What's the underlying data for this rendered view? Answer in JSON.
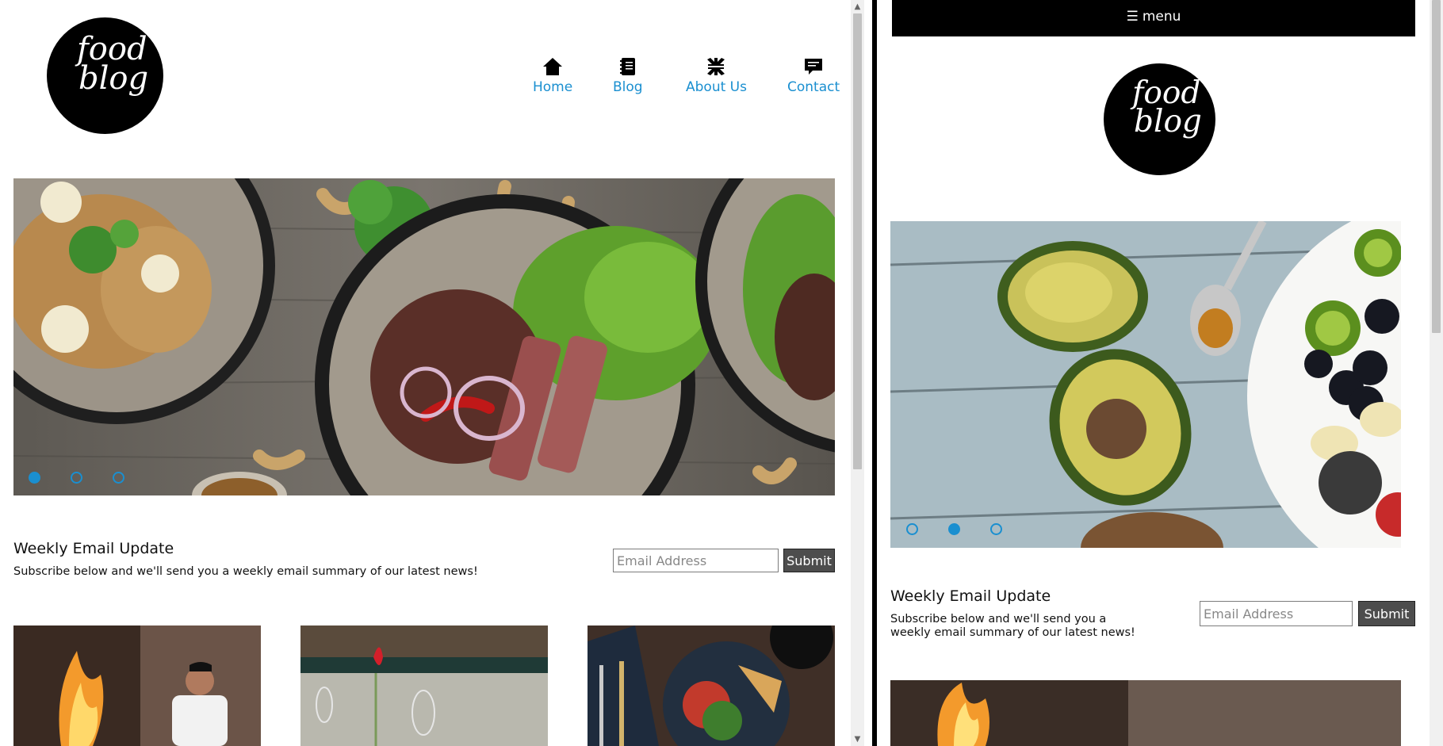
{
  "desktop": {
    "logo": {
      "line1": "food",
      "line2": "blog"
    },
    "nav": [
      {
        "label": "Home",
        "icon": "home-icon"
      },
      {
        "label": "Blog",
        "icon": "notebook-icon"
      },
      {
        "label": "About Us",
        "icon": "collapse-arrows-icon"
      },
      {
        "label": "Contact",
        "icon": "chat-icon"
      }
    ],
    "slideshow": {
      "slide_count": 3,
      "active_index": 0,
      "image": "steak-salad-dishes-photo"
    },
    "newsletter": {
      "title": "Weekly Email Update",
      "subtitle": "Subscribe below and we'll send you a weekly email summary of our latest news!",
      "email_placeholder": "Email Address",
      "submit_label": "Submit"
    },
    "thumbnails": [
      "chef-flambe-photo",
      "dinner-table-rose-photo",
      "quiche-salad-plate-photo"
    ]
  },
  "mobile": {
    "menu_label": "menu",
    "menu_icon": "hamburger-icon",
    "logo": {
      "line1": "food",
      "line2": "blog"
    },
    "slideshow": {
      "slide_count": 3,
      "active_index": 1,
      "image": "avocado-fruit-bowl-photo"
    },
    "newsletter": {
      "title": "Weekly Email Update",
      "subtitle_line1": "Subscribe below and we'll send you a",
      "subtitle_line2": "weekly email summary of our latest news!",
      "email_placeholder": "Email Address",
      "submit_label": "Submit"
    },
    "thumbnails": [
      "chef-flambe-photo"
    ]
  },
  "colors": {
    "accent": "#1a8fd0",
    "menubar": "#000000",
    "button": "#4d4d4d"
  }
}
